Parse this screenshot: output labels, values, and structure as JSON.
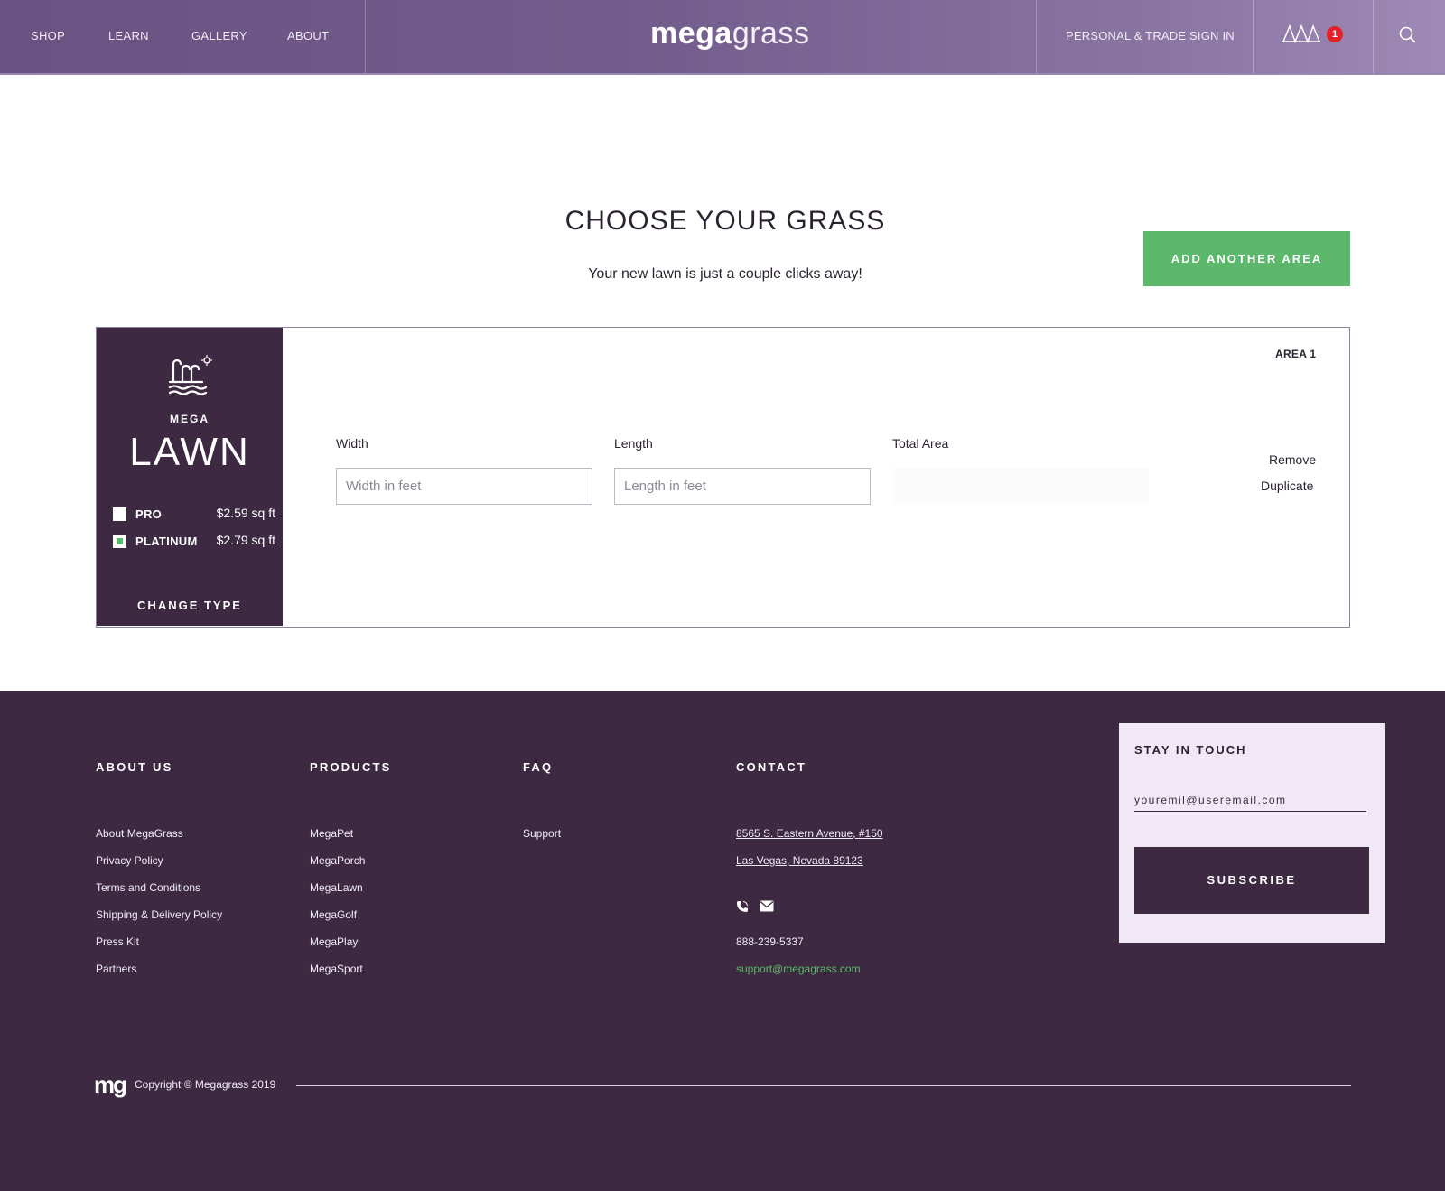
{
  "header": {
    "nav": [
      "SHOP",
      "LEARN",
      "GALLERY",
      "ABOUT"
    ],
    "logo_bold": "mega",
    "logo_light": "grass",
    "signin": "PERSONAL & TRADE SIGN IN",
    "cart_count": "1",
    "cart_icon": "mountains-cart-icon",
    "search_icon": "search-icon"
  },
  "main": {
    "title": "CHOOSE YOUR GRASS",
    "subtitle": "Your new lawn is just a couple clicks away!",
    "add_area_label": "ADD ANOTHER AREA",
    "area": {
      "label": "AREA 1",
      "product": {
        "icon": "lawn-icon",
        "brand": "MEGA",
        "name": "LAWN",
        "tiers": [
          {
            "name": "PRO",
            "price": "$2.59 sq ft",
            "selected": false
          },
          {
            "name": "PLATINUM",
            "price": "$2.79 sq ft",
            "selected": true
          }
        ],
        "change_type": "CHANGE TYPE"
      },
      "fields": {
        "width_label": "Width",
        "width_placeholder": "Width in feet",
        "length_label": "Length",
        "length_placeholder": "Length in feet",
        "total_label": "Total Area",
        "total_value": ""
      },
      "actions": {
        "remove": "Remove",
        "duplicate": "Duplicate"
      }
    }
  },
  "footer": {
    "columns": [
      {
        "heading": "ABOUT US",
        "links": [
          "About MegaGrass",
          "Privacy Policy",
          "Terms and Conditions",
          "Shipping & Delivery Policy",
          "Press Kit",
          "Partners"
        ]
      },
      {
        "heading": "PRODUCTS",
        "links": [
          "MegaPet",
          "MegaPorch",
          "MegaLawn",
          "MegaGolf",
          "MegaPlay",
          "MegaSport"
        ]
      },
      {
        "heading": "FAQ",
        "links": [
          "Support"
        ]
      }
    ],
    "contact": {
      "heading": "CONTACT",
      "address_line1": "8565 S. Eastern Avenue, #150",
      "address_line2": "Las Vegas, Nevada 89123",
      "phone": "888-239-5337",
      "email": "support@megagrass.com",
      "icons": [
        "phone-icon",
        "mail-icon"
      ]
    },
    "newsletter": {
      "title": "STAY IN TOUCH",
      "email_placeholder": "youremil@useremail.com",
      "subscribe_label": "SUBSCRIBE"
    },
    "logo": "mg",
    "copyright": "Copyright © Megagrass 2019"
  },
  "colors": {
    "header_start": "#6a5282",
    "header_end": "#9f8ab5",
    "dark_purple": "#3d2a42",
    "accent_green": "#5cb86a",
    "badge_red": "#e5202a",
    "newsletter_bg": "#f0e8f5"
  }
}
